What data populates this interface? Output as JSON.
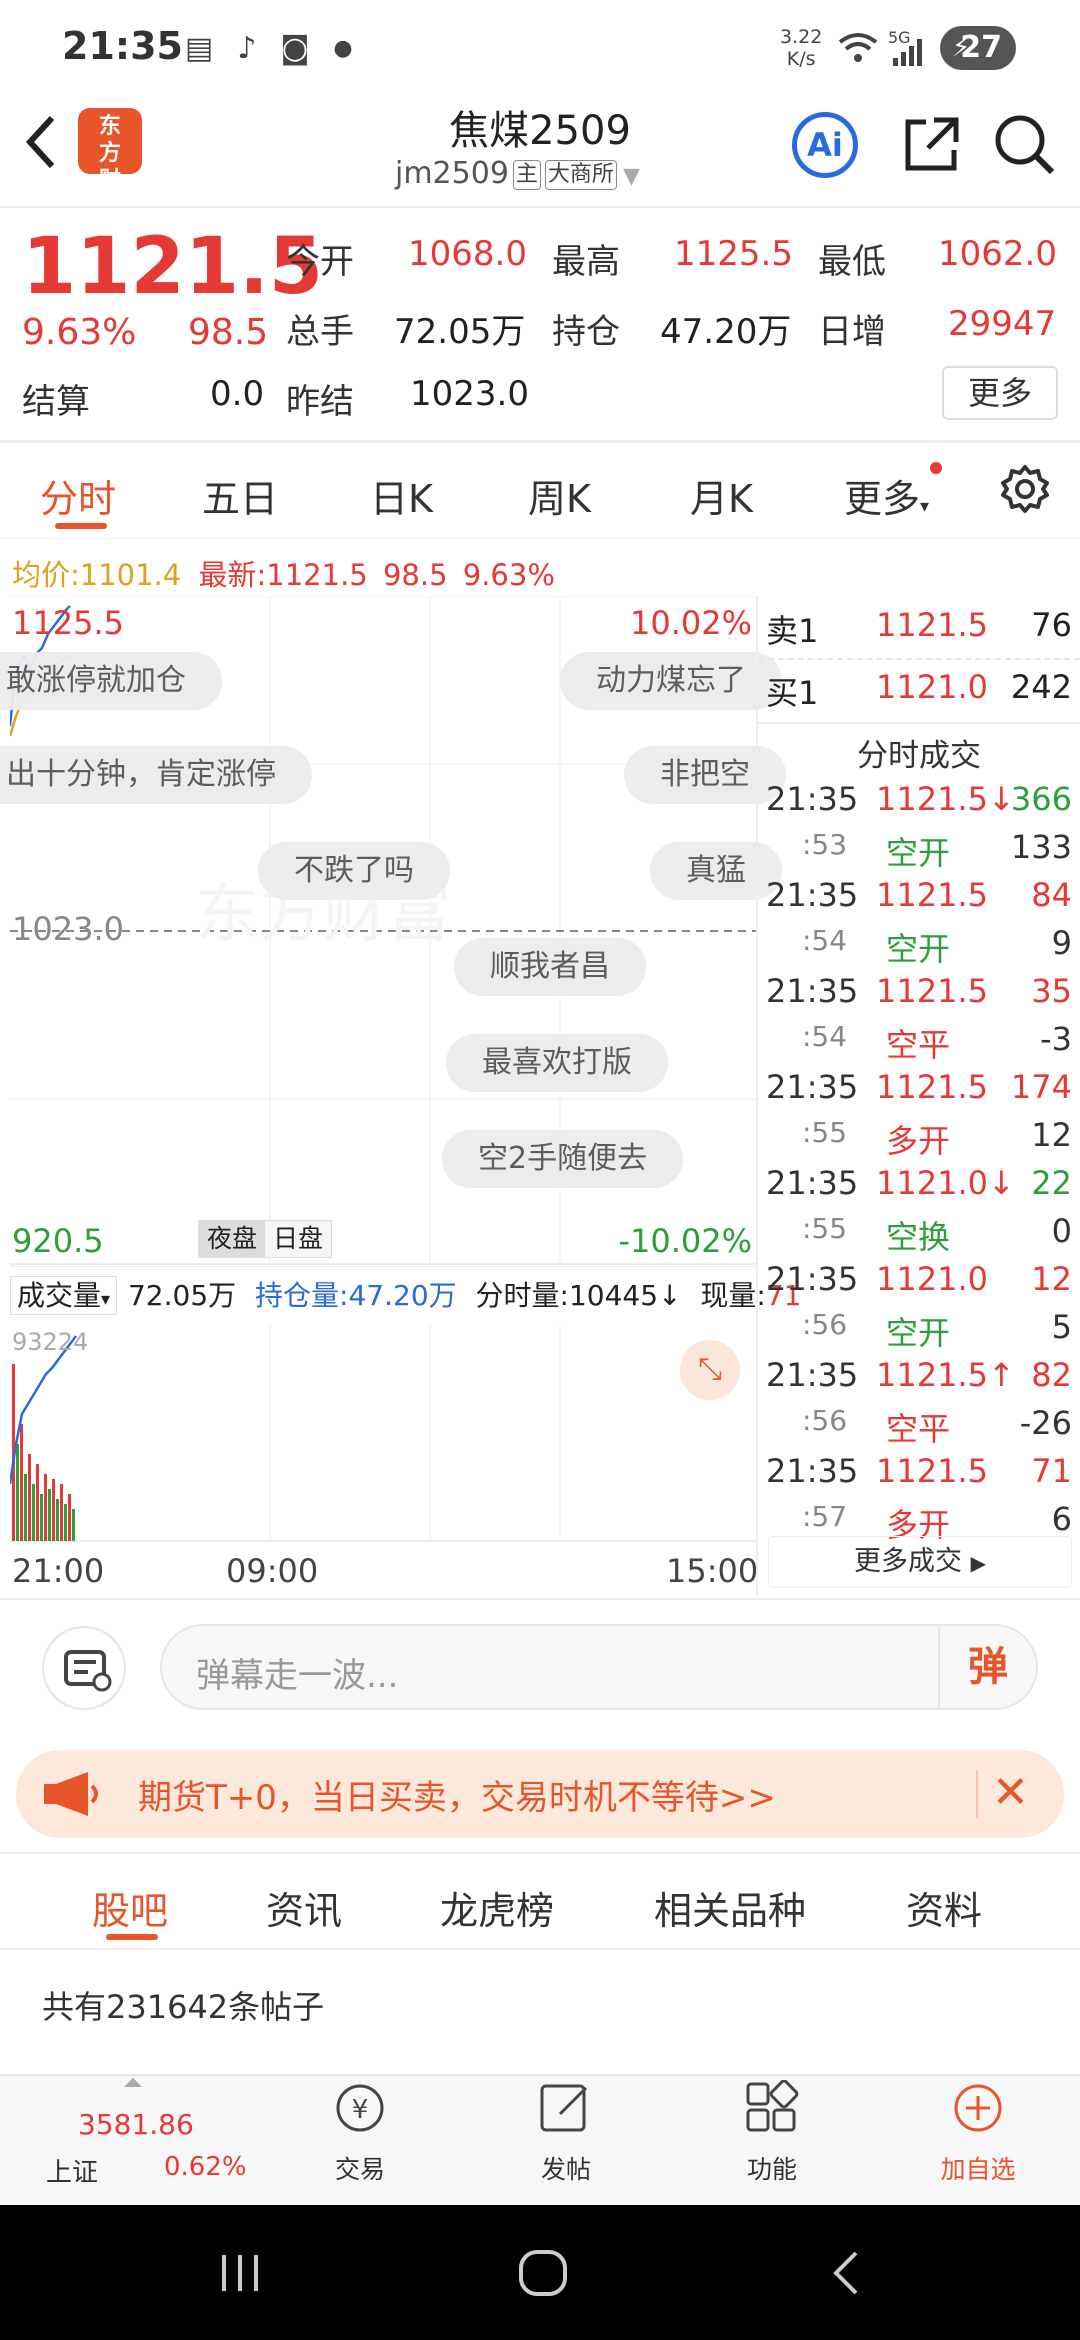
{
  "status": {
    "time": "21:35",
    "speed": "3.22",
    "speed_unit": "K/s",
    "network": "5G",
    "battery": "27"
  },
  "header": {
    "title": "焦煤2509",
    "code": "jm2509",
    "tag_main": "主",
    "exchange": "大商所",
    "logo_text": "东方财富",
    "ai_label": "Ai"
  },
  "quote": {
    "price": "1121.5",
    "pct": "9.63%",
    "change": "98.5",
    "open_label": "今开",
    "open": "1068.0",
    "high_label": "最高",
    "high": "1125.5",
    "low_label": "最低",
    "low": "1062.0",
    "volume_label": "总手",
    "volume": "72.05万",
    "oi_label": "持仓",
    "oi": "47.20万",
    "daily_inc_label": "日增",
    "daily_inc": "29947",
    "settle_label": "结算",
    "settle": "0.0",
    "prev_settle_label": "昨结",
    "prev_settle": "1023.0",
    "more_label": "更多"
  },
  "tabs": [
    "分时",
    "五日",
    "日K",
    "周K",
    "月K",
    "更多"
  ],
  "avg_line": {
    "avg_label": "均价:",
    "avg": "1101.4",
    "latest_label": "最新:",
    "latest": "1121.5",
    "change": "98.5",
    "pct": "9.63%"
  },
  "chart": {
    "top_price": "1125.5",
    "top_pct": "10.02%",
    "mid_price": "1023.0",
    "bottom_price": "920.5",
    "bottom_pct": "-10.02%",
    "session_night": "夜盘",
    "session_day": "日盘",
    "vol_dropdown": "成交量",
    "vol_value": "72.05万",
    "oi_text": "持仓量:47.20万",
    "time_vol_text": "分时量:10445↓",
    "now_vol_label": "现量:",
    "now_vol": "71",
    "vol_max": "93224",
    "time_labels": [
      "21:00",
      "09:00",
      "15:00"
    ],
    "watermark": "东方财富"
  },
  "bullets": [
    "敢涨停就加仓",
    "动力煤忘了",
    "出十分钟，肯定涨停",
    "非把空",
    "不跌了吗",
    "真猛",
    "顺我者昌",
    "最喜欢打版",
    "空2手随便去"
  ],
  "order_book": {
    "sell_label": "卖1",
    "sell_price": "1121.5",
    "sell_qty": "76",
    "buy_label": "买1",
    "buy_price": "1121.0",
    "buy_qty": "242",
    "deals_title": "分时成交",
    "deals": [
      {
        "time": "21:35",
        "price": "1121.5↓",
        "qty": "366"
      },
      {
        "time": ":53",
        "type": "空开",
        "qty": "133"
      },
      {
        "time": "21:35",
        "price": "1121.5",
        "qty": "84"
      },
      {
        "time": ":54",
        "type": "空开",
        "qty": "9"
      },
      {
        "time": "21:35",
        "price": "1121.5",
        "qty": "35"
      },
      {
        "time": ":54",
        "type": "空平",
        "qty": "-3"
      },
      {
        "time": "21:35",
        "price": "1121.5",
        "qty": "174"
      },
      {
        "time": ":55",
        "type": "多开",
        "qty": "12"
      },
      {
        "time": "21:35",
        "price": "1121.0↓",
        "qty": "22"
      },
      {
        "time": ":55",
        "type": "空换",
        "qty": "0"
      },
      {
        "time": "21:35",
        "price": "1121.0",
        "qty": "12"
      },
      {
        "time": ":56",
        "type": "空开",
        "qty": "5"
      },
      {
        "time": "21:35",
        "price": "1121.5↑",
        "qty": "82"
      },
      {
        "time": ":56",
        "type": "空平",
        "qty": "-26"
      },
      {
        "time": "21:35",
        "price": "1121.5",
        "qty": "71"
      },
      {
        "time": ":57",
        "type": "多开",
        "qty": "6"
      }
    ],
    "more_deals": "更多成交"
  },
  "danmu": {
    "placeholder": "弹幕走一波...",
    "send_label": "弹"
  },
  "promo": {
    "text": "期货T+0，当日买卖，交易时机不等待>>"
  },
  "sub_tabs": [
    "股吧",
    "资讯",
    "龙虎榜",
    "相关品种",
    "资料"
  ],
  "posts_count": "共有231642条帖子",
  "bottom_nav": {
    "index_value": "3581.86",
    "index_name": "上证",
    "index_pct": "0.62%",
    "items": [
      "交易",
      "发帖",
      "功能",
      "加自选"
    ]
  },
  "colors": {
    "up": "#e53935",
    "down": "#2e9e3a",
    "accent": "#e8552b",
    "blue": "#2a6ae0"
  }
}
